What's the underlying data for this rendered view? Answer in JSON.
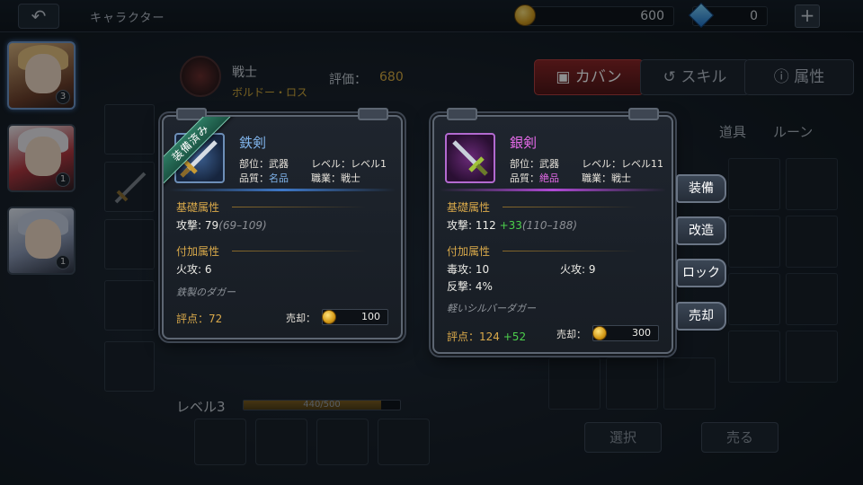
{
  "top_bar": {
    "back_icon": "back-arrow-icon",
    "title": "キャラクター",
    "gold": "600",
    "gems": "0",
    "plus_icon": "plus-icon"
  },
  "characters": [
    {
      "badge": "3",
      "selected": true
    },
    {
      "badge": "1",
      "selected": false
    },
    {
      "badge": "1",
      "selected": false
    }
  ],
  "hero": {
    "class_name": "戦士",
    "hero_name": "ボルドー・ロス",
    "rating_label": "評価：",
    "rating_value": "680"
  },
  "tabs": {
    "bag": "カバン",
    "skill": "スキル",
    "attribute": "属性"
  },
  "subtabs": {
    "item": "道具",
    "rune": "ルーン"
  },
  "bottom": {
    "level": "レベル3",
    "exp_text": "440/500",
    "exp_fraction": 0.88,
    "select_label": "選択",
    "sell_label": "売る"
  },
  "cards": {
    "iron": {
      "equipped_label": "装備済み",
      "name": "鉄剣",
      "slot_label": "部位：",
      "slot_value": "武器",
      "level_label": "レベル：",
      "level_value": "レベル1",
      "quality_label": "品質：",
      "quality_value": "名品",
      "job_label": "職業：",
      "job_value": "戦士",
      "base_title": "基礎属性",
      "attack_label": "攻撃: ",
      "attack_value": "79",
      "attack_range": "(69–109)",
      "extra_title": "付加属性",
      "fire_attack": "火攻: 6",
      "flavor": "鉄製のダガー",
      "score_label": "評点：",
      "score_value": "72",
      "sell_label": "売却：",
      "sell_price": "100",
      "quality_color": "#7fb3ea"
    },
    "silver": {
      "name": "銀剣",
      "slot_label": "部位：",
      "slot_value": "武器",
      "level_label": "レベル：",
      "level_value": "レベル11",
      "quality_label": "品質：",
      "quality_value": "絶品",
      "job_label": "職業：",
      "job_value": "戦士",
      "base_title": "基礎属性",
      "attack_label": "攻撃: ",
      "attack_value": "112",
      "attack_bonus": "+33",
      "attack_range": "(110–188)",
      "extra_title": "付加属性",
      "poison_attack": "毒攻: 10",
      "fire_attack": "火攻: 9",
      "counter": "反撃: 4%",
      "flavor": "軽いシルバーダガー",
      "score_label": "評点：",
      "score_value": "124",
      "score_bonus": "+52",
      "sell_label": "売却：",
      "sell_price": "300",
      "quality_color": "#e46ae8"
    }
  },
  "side_actions": {
    "equip": "装備",
    "modify": "改造",
    "lock": "ロック",
    "sell": "売却"
  }
}
